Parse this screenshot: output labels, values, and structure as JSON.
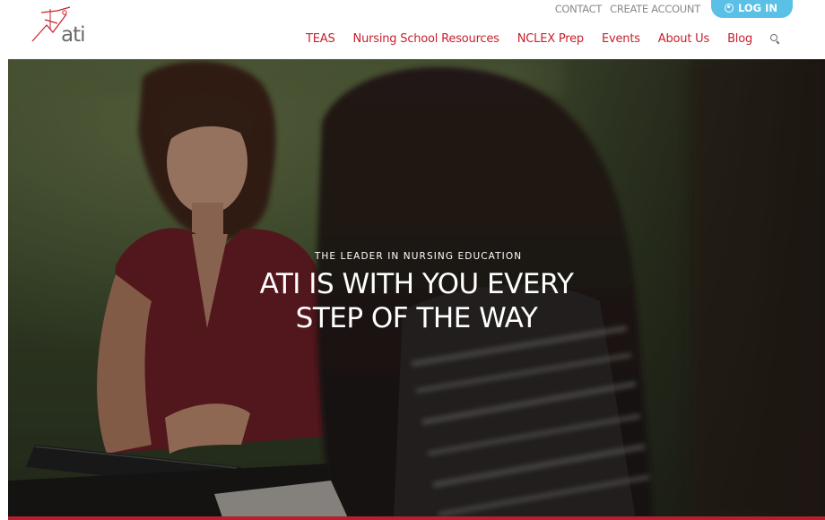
{
  "header": {
    "logo_text": "ati",
    "utility": {
      "contact": "CONTACT",
      "create_account": "CREATE ACCOUNT",
      "login": "LOG IN"
    },
    "nav": [
      "TEAS",
      "Nursing School Resources",
      "NCLEX Prep",
      "Events",
      "About Us",
      "Blog"
    ]
  },
  "hero": {
    "kicker": "THE LEADER IN NURSING EDUCATION",
    "title_line1": "ATI IS WITH YOU EVERY",
    "title_line2": "STEP OF THE WAY"
  },
  "colors": {
    "brand_red": "#c8202e",
    "login_blue": "#5bc0e5",
    "utility_gray": "#8a8a8a"
  },
  "icons": [
    "ati-logo-icon",
    "user-icon",
    "search-icon"
  ]
}
